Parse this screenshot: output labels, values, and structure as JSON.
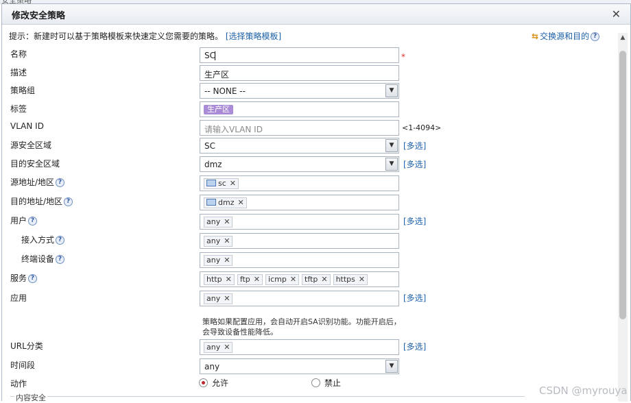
{
  "background_label": "安全策略",
  "dialog": {
    "title": "修改安全策略",
    "tip_text": "提示：新建时可以基于策略模板来快速定义您需要的策略。",
    "tip_link": "[选择策略模板]",
    "swap_label": "交换源和目的"
  },
  "form": {
    "name": {
      "label": "名称",
      "value": "SC",
      "required_mark": "*"
    },
    "description": {
      "label": "描述",
      "value": "生产区"
    },
    "policy_group": {
      "label": "策略组",
      "value": "-- NONE --"
    },
    "tag": {
      "label": "标签",
      "value": "生产区"
    },
    "vlan": {
      "label": "VLAN ID",
      "placeholder": "请输入VLAN ID",
      "hint": "<1-4094>"
    },
    "source_zone": {
      "label": "源安全区域",
      "value": "SC",
      "multi": "[多选]"
    },
    "dest_zone": {
      "label": "目的安全区域",
      "value": "dmz",
      "multi": "[多选]"
    },
    "source_address": {
      "label": "源地址/地区",
      "chips": [
        "sc"
      ]
    },
    "dest_address": {
      "label": "目的地址/地区",
      "chips": [
        "dmz"
      ]
    },
    "user": {
      "label": "用户",
      "chips": [
        "any"
      ],
      "multi": "[多选]"
    },
    "access_mode": {
      "label": "接入方式",
      "chips": [
        "any"
      ]
    },
    "terminal": {
      "label": "终端设备",
      "chips": [
        "any"
      ]
    },
    "service": {
      "label": "服务",
      "chips": [
        "http",
        "ftp",
        "icmp",
        "tftp",
        "https"
      ]
    },
    "application": {
      "label": "应用",
      "chips": [
        "any"
      ],
      "multi": "[多选]",
      "note": "策略如果配置应用，会自动开启SA识别功能。功能开启后，会导致设备性能降低。"
    },
    "url_category": {
      "label": "URL分类",
      "chips": [
        "any"
      ],
      "multi": "[多选]"
    },
    "time_range": {
      "label": "时间段",
      "value": "any"
    },
    "action": {
      "label": "动作",
      "options": [
        "允许",
        "禁止"
      ],
      "selected": "允许"
    },
    "content_security": {
      "label": "内容安全"
    }
  },
  "watermark": "CSDN @myrouya",
  "colors": {
    "accent_link": "#1d5fa8",
    "tag_purple": "#a98bd6",
    "required": "#e03030",
    "radio_on": "#c0262d"
  }
}
